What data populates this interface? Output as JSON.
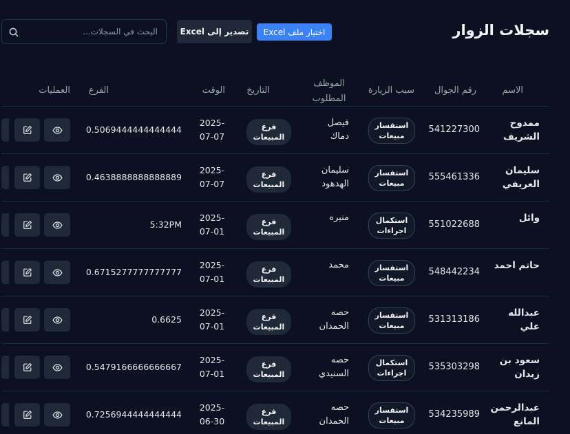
{
  "header": {
    "title": "سجلات الزوار",
    "import_label": "اختيار ملف Excel",
    "export_label": "تصدير إلى Excel",
    "search_placeholder": "البحث في السجلات..."
  },
  "table": {
    "columns": {
      "name": "الاسم",
      "phone": "رقم الجوال",
      "reason": "سبب الزيارة",
      "employee": "الموظف المطلوب",
      "date": "التاريخ",
      "time": "الوقت",
      "branch": "الفرع",
      "actions": "العمليات"
    },
    "rows": [
      {
        "name": "ممدوح الشريف",
        "phone": "541227300",
        "reason": "استفسار مبيعات",
        "employee": "فيصل دماك",
        "date": "2025-07-07",
        "time": "0.5069444444444444",
        "branch": "فرع المبيعات"
      },
      {
        "name": "سليمان العريفي",
        "phone": "555461336",
        "reason": "استفسار مبيعات",
        "employee": "سليمان الهدهود",
        "date": "2025-07-07",
        "time": "0.4638888888888889",
        "branch": "فرع المبيعات"
      },
      {
        "name": "وائل",
        "phone": "551022688",
        "reason": "استكمال اجراءات",
        "employee": "منيره",
        "date": "2025-07-01",
        "time": "5:32PM",
        "branch": "فرع المبيعات"
      },
      {
        "name": "حاتم احمد",
        "phone": "548442234",
        "reason": "استفسار مبيعات",
        "employee": "محمد",
        "date": "2025-07-01",
        "time": "0.6715277777777777",
        "branch": "فرع المبيعات"
      },
      {
        "name": "عبدالله علي",
        "phone": "531313186",
        "reason": "استفسار مبيعات",
        "employee": "حصه الحمدان",
        "date": "2025-07-01",
        "time": "0.6625",
        "branch": "فرع المبيعات"
      },
      {
        "name": "سعود بن زيدان",
        "phone": "535303298",
        "reason": "استكمال اجراءات",
        "employee": "حصه السنيدي",
        "date": "2025-07-01",
        "time": "0.5479166666666667",
        "branch": "فرع المبيعات"
      },
      {
        "name": "عبدالرحمن المانع",
        "phone": "534235989",
        "reason": "استفسار مبيعات",
        "employee": "حصه الحمدان",
        "date": "2025-06-30",
        "time": "0.7256944444444444",
        "branch": "فرع المبيعات"
      }
    ]
  },
  "icons": {
    "search": "search-icon",
    "view": "eye-icon",
    "edit": "edit-icon"
  },
  "colors": {
    "background": "#0b1120",
    "accent": "#3b82f6",
    "button_dark": "#1f2937"
  }
}
